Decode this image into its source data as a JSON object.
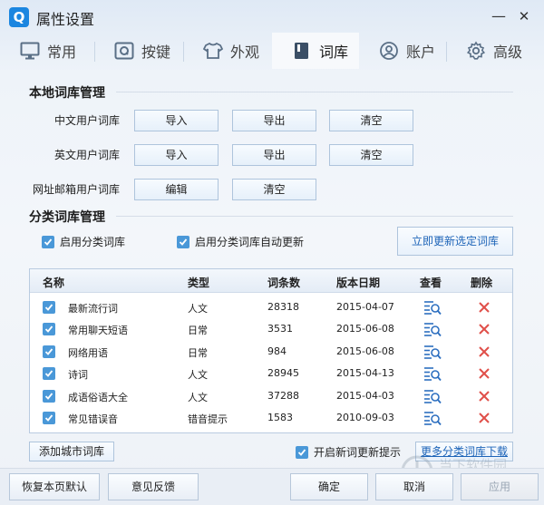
{
  "window": {
    "title": "属性设置",
    "logo_letter": "Q",
    "minimize": "—",
    "close": "✕"
  },
  "tabs": [
    {
      "label": "常用",
      "icon": "monitor-icon",
      "active": false
    },
    {
      "label": "按键",
      "icon": "keyboard-q-icon",
      "active": false
    },
    {
      "label": "外观",
      "icon": "tshirt-icon",
      "active": false
    },
    {
      "label": "词库",
      "icon": "book-icon",
      "active": true
    },
    {
      "label": "账户",
      "icon": "user-icon",
      "active": false
    },
    {
      "label": "高级",
      "icon": "gear-icon",
      "active": false
    }
  ],
  "local": {
    "section_title": "本地词库管理",
    "rows": [
      {
        "label": "中文用户词库",
        "buttons": [
          "导入",
          "导出",
          "清空"
        ]
      },
      {
        "label": "英文用户词库",
        "buttons": [
          "导入",
          "导出",
          "清空"
        ]
      },
      {
        "label": "网址邮箱用户词库",
        "buttons": [
          "编辑",
          "清空"
        ]
      }
    ]
  },
  "category": {
    "section_title": "分类词库管理",
    "enable_label": "启用分类词库",
    "enable_checked": true,
    "auto_update_label": "启用分类词库自动更新",
    "auto_update_checked": true,
    "update_now_button": "立即更新选定词库",
    "columns": [
      "名称",
      "类型",
      "词条数",
      "版本日期",
      "查看",
      "删除"
    ],
    "rows": [
      {
        "checked": true,
        "name": "最新流行词",
        "type": "人文",
        "count": "28318",
        "date": "2015-04-07"
      },
      {
        "checked": true,
        "name": "常用聊天短语",
        "type": "日常",
        "count": "3531",
        "date": "2015-06-08"
      },
      {
        "checked": true,
        "name": "网络用语",
        "type": "日常",
        "count": "984",
        "date": "2015-06-08"
      },
      {
        "checked": true,
        "name": "诗词",
        "type": "人文",
        "count": "28945",
        "date": "2015-04-13"
      },
      {
        "checked": true,
        "name": "成语俗语大全",
        "type": "人文",
        "count": "37288",
        "date": "2015-04-03"
      },
      {
        "checked": true,
        "name": "常见错误音",
        "type": "错音提示",
        "count": "1583",
        "date": "2010-09-03"
      }
    ],
    "add_city_button": "添加城市词库",
    "new_word_prompt_label": "开启新词更新提示",
    "new_word_prompt_checked": true,
    "more_download_button": "更多分类词库下载"
  },
  "footer": {
    "restore_default": "恢复本页默认",
    "feedback": "意见反馈",
    "ok": "确定",
    "cancel": "取消",
    "apply": "应用"
  },
  "watermark": {
    "text": "当下软件园",
    "sub": "www.downxia.com"
  },
  "colors": {
    "accent": "#1b86e0",
    "check": "#4a98d8",
    "delete": "#e0504a",
    "link": "#1d64b8"
  }
}
